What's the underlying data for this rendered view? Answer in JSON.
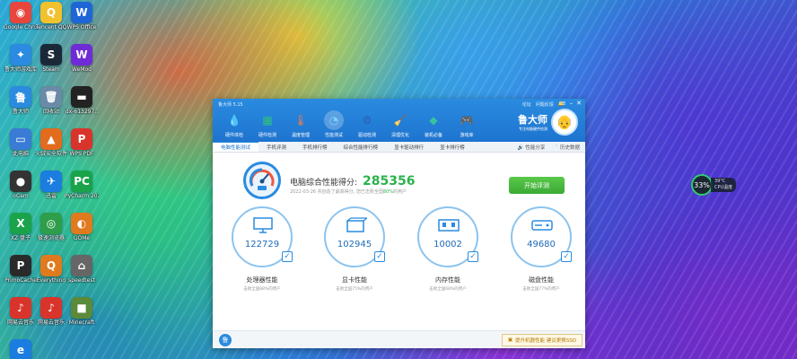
{
  "desktop": {
    "icons": [
      {
        "label": "Google Chrome",
        "glyph": "◉",
        "color": "#e8453c"
      },
      {
        "label": "Tencent QQ",
        "glyph": "Q",
        "color": "#f2c12e"
      },
      {
        "label": "WPS Office",
        "glyph": "W",
        "color": "#1e66d6"
      },
      {
        "label": "鲁大师游戏库",
        "glyph": "✦",
        "color": "#2a8be0"
      },
      {
        "label": "Steam",
        "glyph": "S",
        "color": "#1b2838"
      },
      {
        "label": "WeMod",
        "glyph": "W",
        "color": "#6f2bd6"
      },
      {
        "label": "鲁大师",
        "glyph": "鲁",
        "color": "#2a8be0"
      },
      {
        "label": "回收站",
        "glyph": "🗑",
        "color": "#6a8aa8"
      },
      {
        "label": "dx-613297..",
        "glyph": "▬",
        "color": "#222222"
      },
      {
        "label": "此电脑",
        "glyph": "▭",
        "color": "#3a7bd5"
      },
      {
        "label": "火绒安全软件",
        "glyph": "▲",
        "color": "#e26b1e"
      },
      {
        "label": "WPS PDF",
        "glyph": "P",
        "color": "#d9342b"
      },
      {
        "label": "oCam",
        "glyph": "●",
        "color": "#333333"
      },
      {
        "label": "迅雷",
        "glyph": "✈",
        "color": "#1b7de0"
      },
      {
        "label": "PyCharm 2021.3.2",
        "glyph": "PC",
        "color": "#1aa34a"
      },
      {
        "label": "XZ 盘子",
        "glyph": "X",
        "color": "#1aa34a"
      },
      {
        "label": "极速浏览器",
        "glyph": "◎",
        "color": "#2e9e4a"
      },
      {
        "label": "GOMe",
        "glyph": "◐",
        "color": "#e07a1e"
      },
      {
        "label": "PrimoCache",
        "glyph": "P",
        "color": "#2a2a2a"
      },
      {
        "label": "Everything",
        "glyph": "Q",
        "color": "#e07a1e"
      },
      {
        "label": "speedtest",
        "glyph": "⌂",
        "color": "#666666"
      },
      {
        "label": "网易云音乐",
        "glyph": "♪",
        "color": "#d9342b"
      },
      {
        "label": "网易云音乐",
        "glyph": "♪",
        "color": "#d9342b"
      },
      {
        "label": "Minecraft",
        "glyph": "■",
        "color": "#5a8a3a"
      },
      {
        "label": "Edge",
        "glyph": "e",
        "color": "#1b7de0"
      }
    ]
  },
  "cpu_widget": {
    "percent": "33%",
    "temp": "39°C",
    "label": "CPU温度"
  },
  "window": {
    "title": "鲁大师 5.15",
    "title_links": [
      "论坛",
      "问题反馈",
      "🔔"
    ],
    "brand_name": "鲁大师",
    "brand_sub": "专注电脑硬件检测",
    "nav": [
      {
        "label": "硬件体检",
        "glyph": "💧",
        "color": "#5cc8f0"
      },
      {
        "label": "硬件检测",
        "glyph": "▦",
        "color": "#2ec27e"
      },
      {
        "label": "温度管理",
        "glyph": "🌡",
        "color": "#ff7a3d"
      },
      {
        "label": "性能测试",
        "glyph": "◔",
        "color": "#7fd0ff"
      },
      {
        "label": "驱动检测",
        "glyph": "⚙",
        "color": "#2a5fb0"
      },
      {
        "label": "清理优化",
        "glyph": "🧹",
        "color": "#e8a43a"
      },
      {
        "label": "装机必备",
        "glyph": "◆",
        "color": "#3ac2a0"
      },
      {
        "label": "游戏库",
        "glyph": "🎮",
        "color": "#ff6a6a"
      }
    ],
    "tabs": [
      "电脑性能测试",
      "手机评测",
      "手机排行榜",
      "综合性能排行榜",
      "显卡驱动排行",
      "显卡排行榜"
    ],
    "tab_tools": [
      "🔊 性能分享",
      "📄 历史数据"
    ],
    "score": {
      "title": "电脑综合性能得分:",
      "value": "285356",
      "sub_prefix": "2022-03-26 共创造了最高得分, 您已击败全国",
      "sub_percent": "80%",
      "sub_suffix": "的用户"
    },
    "eval_button": "开始评测",
    "cards": [
      {
        "name": "处理器性能",
        "value": "122729",
        "sub": "击败全国88%的用户"
      },
      {
        "name": "显卡性能",
        "value": "102945",
        "sub": "击败全国75%的用户"
      },
      {
        "name": "内存性能",
        "value": "10002",
        "sub": "击败全国68%的用户"
      },
      {
        "name": "磁盘性能",
        "value": "49680",
        "sub": "击败全国77%的用户"
      }
    ],
    "ssd_promo": "提升机器性能 建议更换SSD"
  }
}
